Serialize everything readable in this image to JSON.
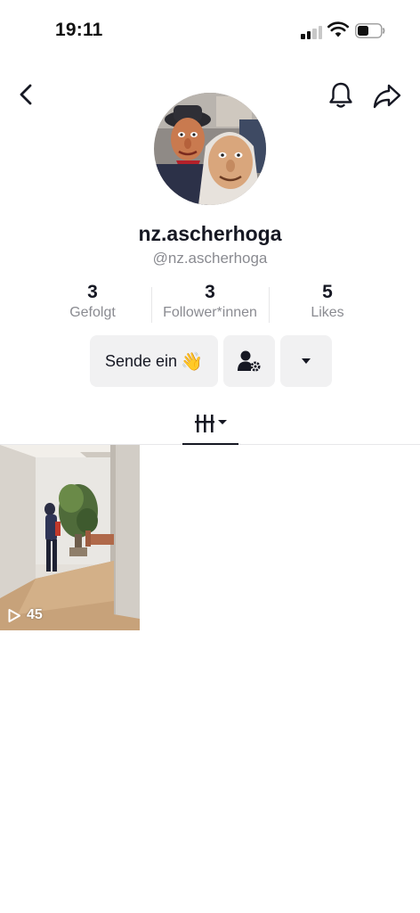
{
  "status_bar": {
    "time": "19:11"
  },
  "nav": {
    "back_icon": "chevron-left-icon",
    "bell_icon": "bell-icon",
    "share_icon": "share-arrow-icon"
  },
  "profile": {
    "display_name": "nz.ascherhoga",
    "handle": "@nz.ascherhoga"
  },
  "stats": {
    "following": {
      "value": "3",
      "label": "Gefolgt"
    },
    "followers": {
      "value": "3",
      "label": "Follower*innen"
    },
    "likes": {
      "value": "5",
      "label": "Likes"
    }
  },
  "actions": {
    "send_label": "Sende ein",
    "send_emoji": "👋",
    "friend_settings_icon": "person-gear-icon",
    "dropdown_icon": "caret-down-icon"
  },
  "tabs": {
    "videos_icon": "grid-bars-icon"
  },
  "videos": [
    {
      "views": "45"
    }
  ],
  "colors": {
    "text_primary": "#161823",
    "text_secondary": "#8a8b91",
    "button_bg": "#f1f1f2"
  }
}
